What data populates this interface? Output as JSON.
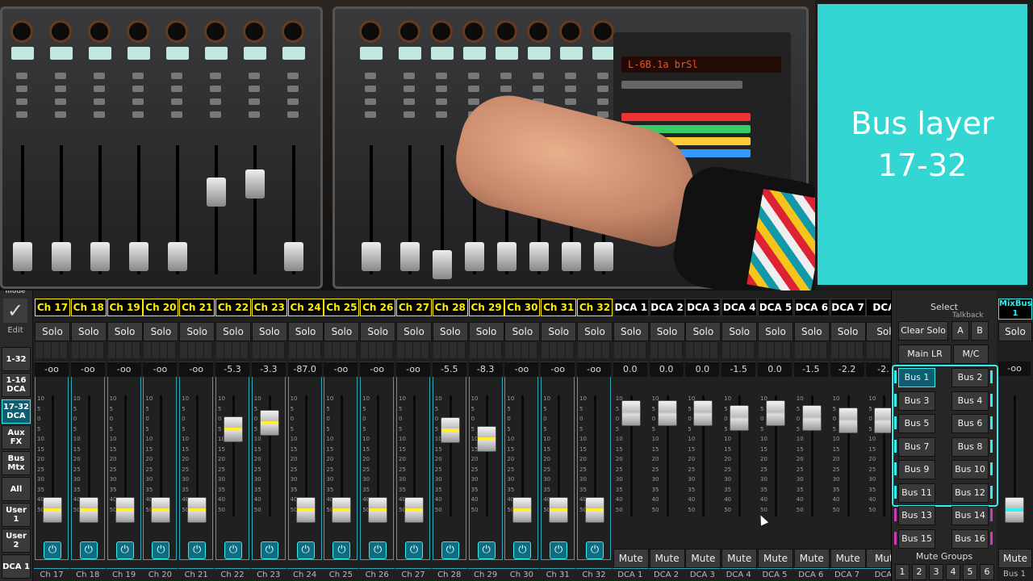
{
  "card": {
    "line1": "Bus layer",
    "line2": "17-32",
    "color": "#34d6d4"
  },
  "photo": {
    "lcd_text": "L-6B.1a  brSl"
  },
  "leftbar": {
    "edit_label": "Edit",
    "top_label": "mode",
    "layers": [
      "1-32",
      "1-16 DCA",
      "17-32 DCA",
      "Aux FX",
      "Bus Mtx",
      "All",
      "User 1",
      "User 2",
      "DCA 1"
    ],
    "active_layer_index": 2
  },
  "strips": [
    {
      "name": "Ch 17",
      "kind": "ch",
      "solo": "Solo",
      "value": "-oo",
      "level": 0.06,
      "foot": "Ch 17"
    },
    {
      "name": "Ch 18",
      "kind": "ch",
      "solo": "Solo",
      "value": "-oo",
      "level": 0.06,
      "foot": "Ch 18"
    },
    {
      "name": "Ch 19",
      "kind": "ch",
      "solo": "Solo",
      "value": "-oo",
      "level": 0.06,
      "foot": "Ch 19"
    },
    {
      "name": "Ch 20",
      "kind": "ch",
      "solo": "Solo",
      "value": "-oo",
      "level": 0.06,
      "foot": "Ch 20"
    },
    {
      "name": "Ch 21",
      "kind": "ch",
      "solo": "Solo",
      "value": "-oo",
      "level": 0.06,
      "foot": "Ch 21"
    },
    {
      "name": "Ch 22",
      "kind": "ch",
      "solo": "Solo",
      "value": "-5.3",
      "level": 0.73,
      "foot": "Ch 22"
    },
    {
      "name": "Ch 23",
      "kind": "ch",
      "solo": "Solo",
      "value": "-3.3",
      "level": 0.78,
      "foot": "Ch 23"
    },
    {
      "name": "Ch 24",
      "kind": "ch",
      "solo": "Solo",
      "value": "-87.0",
      "level": 0.06,
      "foot": "Ch 24"
    },
    {
      "name": "Ch 25",
      "kind": "ch",
      "solo": "Solo",
      "value": "-oo",
      "level": 0.06,
      "foot": "Ch 25"
    },
    {
      "name": "Ch 26",
      "kind": "ch",
      "solo": "Solo",
      "value": "-oo",
      "level": 0.06,
      "foot": "Ch 26"
    },
    {
      "name": "Ch 27",
      "kind": "ch",
      "solo": "Solo",
      "value": "-oo",
      "level": 0.06,
      "foot": "Ch 27"
    },
    {
      "name": "Ch 28",
      "kind": "ch",
      "solo": "Solo",
      "value": "-5.5",
      "level": 0.72,
      "foot": "Ch 28"
    },
    {
      "name": "Ch 29",
      "kind": "ch",
      "solo": "Solo",
      "value": "-8.3",
      "level": 0.65,
      "foot": "Ch 29"
    },
    {
      "name": "Ch 30",
      "kind": "ch",
      "solo": "Solo",
      "value": "-oo",
      "level": 0.06,
      "foot": "Ch 30"
    },
    {
      "name": "Ch 31",
      "kind": "ch",
      "solo": "Solo",
      "value": "-oo",
      "level": 0.06,
      "foot": "Ch 31"
    },
    {
      "name": "Ch 32",
      "kind": "ch",
      "solo": "Solo",
      "value": "-oo",
      "level": 0.06,
      "foot": "Ch 32"
    },
    {
      "name": "DCA 1",
      "kind": "dca",
      "solo": "Solo",
      "value": "0.0",
      "level": 0.86,
      "mute": "Mute",
      "foot": "DCA 1"
    },
    {
      "name": "DCA 2",
      "kind": "dca",
      "solo": "Solo",
      "value": "0.0",
      "level": 0.86,
      "mute": "Mute",
      "foot": "DCA 2"
    },
    {
      "name": "DCA 3",
      "kind": "dca",
      "solo": "Solo",
      "value": "0.0",
      "level": 0.86,
      "mute": "Mute",
      "foot": "DCA 3"
    },
    {
      "name": "DCA 4",
      "kind": "dca",
      "solo": "Solo",
      "value": "-1.5",
      "level": 0.82,
      "mute": "Mute",
      "foot": "DCA 4"
    },
    {
      "name": "DCA 5",
      "kind": "dca",
      "solo": "Solo",
      "value": "0.0",
      "level": 0.86,
      "mute": "Mute",
      "foot": "DCA 5"
    },
    {
      "name": "DCA 6",
      "kind": "dca",
      "solo": "Solo",
      "value": "-1.5",
      "level": 0.82,
      "mute": "Mute",
      "foot": "DCA 6"
    },
    {
      "name": "DCA 7",
      "kind": "dca",
      "solo": "Solo",
      "value": "-2.2",
      "level": 0.8,
      "mute": "Mute",
      "foot": "DCA 7"
    },
    {
      "name": "DCA",
      "kind": "dca",
      "solo": "Sol",
      "value": "-2.",
      "level": 0.8,
      "mute": "Mut",
      "foot": "DCA"
    }
  ],
  "scale_labels": [
    "10",
    "5",
    "0",
    "5",
    "10",
    "15",
    "20",
    "25",
    "30",
    "35",
    "40",
    "50"
  ],
  "right_panel": {
    "select_label": "Select",
    "talkback_label": "Talkback",
    "clear_solo": "Clear Solo",
    "talk_a": "A",
    "talk_b": "B",
    "main_lr": "Main LR",
    "mc": "M/C",
    "buses": [
      "Bus 1",
      "Bus 2",
      "Bus 3",
      "Bus 4",
      "Bus 5",
      "Bus 6",
      "Bus 7",
      "Bus 8",
      "Bus 9",
      "Bus 10",
      "Bus 11",
      "Bus 12",
      "Bus 13",
      "Bus 14",
      "Bus 15",
      "Bus 16"
    ],
    "selected_bus_index": 0,
    "mute_groups_label": "Mute Groups",
    "mute_groups": [
      "1",
      "2",
      "3",
      "4",
      "5",
      "6"
    ]
  },
  "mixbus": {
    "name_line1": "MixBus",
    "name_line2": "1",
    "solo": "Solo",
    "value": "-oo",
    "level": 0.06,
    "mute": "Mute",
    "foot": "Bus 1"
  }
}
